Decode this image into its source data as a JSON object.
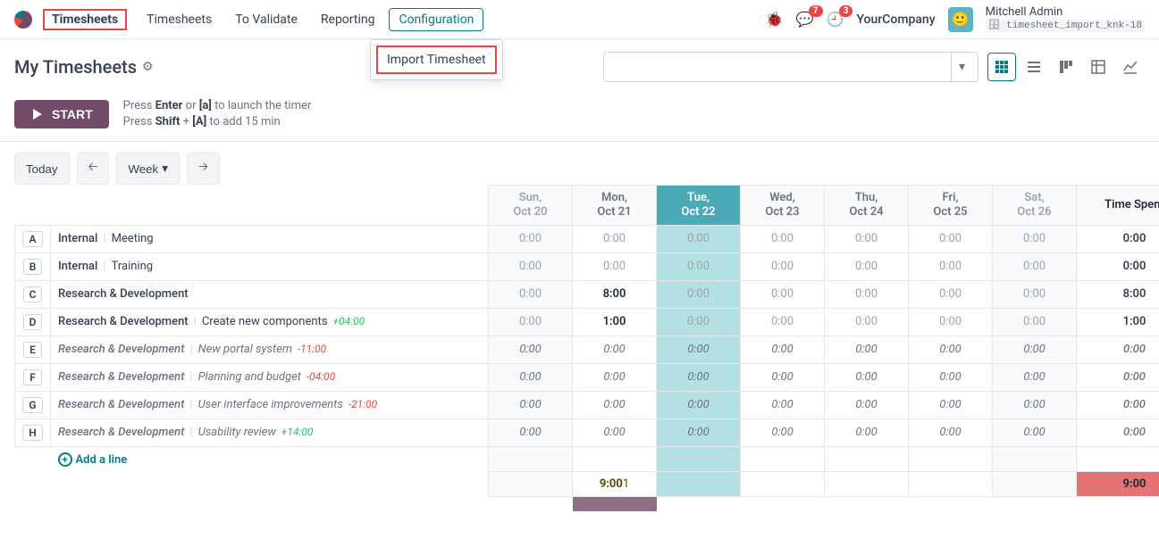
{
  "nav": {
    "app": "Timesheets",
    "links": [
      "Timesheets",
      "To Validate",
      "Reporting",
      "Configuration"
    ],
    "dropdown_item": "Import Timesheet",
    "company": "YourCompany",
    "user": "Mitchell Admin",
    "db": "timesheet_import_knk-18",
    "chat_badge": "7",
    "activity_badge": "3"
  },
  "header": {
    "title": "My Timesheets"
  },
  "hints": {
    "line1_a": "Press ",
    "line1_b": "Enter",
    "line1_c": " or ",
    "line1_d": "[a]",
    "line1_e": " to launch the timer",
    "line2_a": "Press ",
    "line2_b": "Shift",
    "line2_c": " + ",
    "line2_d": "[A]",
    "line2_e": " to add 15 min"
  },
  "start_label": "START",
  "controls": {
    "today": "Today",
    "scale": "Week"
  },
  "days": [
    {
      "top": "Sun,",
      "bot": "Oct 20",
      "kind": "weekend"
    },
    {
      "top": "Mon,",
      "bot": "Oct 21",
      "kind": "normal"
    },
    {
      "top": "Tue,",
      "bot": "Oct 22",
      "kind": "today"
    },
    {
      "top": "Wed,",
      "bot": "Oct 23",
      "kind": "normal"
    },
    {
      "top": "Thu,",
      "bot": "Oct 24",
      "kind": "normal"
    },
    {
      "top": "Fri,",
      "bot": "Oct 25",
      "kind": "normal"
    },
    {
      "top": "Sat,",
      "bot": "Oct 26",
      "kind": "weekend"
    }
  ],
  "time_spent_head": "Time Spent",
  "rows": [
    {
      "key": "A",
      "project": "Internal",
      "task": "Meeting",
      "italic": false,
      "diff": "",
      "cells": [
        "0:00",
        "0:00",
        "0:00",
        "0:00",
        "0:00",
        "0:00",
        "0:00"
      ],
      "spent": "0:00"
    },
    {
      "key": "B",
      "project": "Internal",
      "task": "Training",
      "italic": false,
      "diff": "",
      "cells": [
        "0:00",
        "0:00",
        "0:00",
        "0:00",
        "0:00",
        "0:00",
        "0:00"
      ],
      "spent": "0:00"
    },
    {
      "key": "C",
      "project": "Research & Development",
      "task": "",
      "italic": false,
      "diff": "",
      "cells": [
        "0:00",
        "8:00",
        "0:00",
        "0:00",
        "0:00",
        "0:00",
        "0:00"
      ],
      "spent": "8:00"
    },
    {
      "key": "D",
      "project": "Research & Development",
      "task": "Create new components",
      "italic": false,
      "diff": "+04:00",
      "diffsign": "pos",
      "cells": [
        "0:00",
        "1:00",
        "0:00",
        "0:00",
        "0:00",
        "0:00",
        "0:00"
      ],
      "spent": "1:00"
    },
    {
      "key": "E",
      "project": "Research & Development",
      "task": "New portal system",
      "italic": true,
      "diff": "-11:00",
      "diffsign": "neg",
      "cells": [
        "0:00",
        "0:00",
        "0:00",
        "0:00",
        "0:00",
        "0:00",
        "0:00"
      ],
      "spent": "0:00"
    },
    {
      "key": "F",
      "project": "Research & Development",
      "task": "Planning and budget",
      "italic": true,
      "diff": "-04:00",
      "diffsign": "neg",
      "cells": [
        "0:00",
        "0:00",
        "0:00",
        "0:00",
        "0:00",
        "0:00",
        "0:00"
      ],
      "spent": "0:00"
    },
    {
      "key": "G",
      "project": "Research & Development",
      "task": "User interface improvements",
      "italic": true,
      "diff": "-21:00",
      "diffsign": "neg",
      "cells": [
        "0:00",
        "0:00",
        "0:00",
        "0:00",
        "0:00",
        "0:00",
        "0:00"
      ],
      "spent": "0:00"
    },
    {
      "key": "H",
      "project": "Research & Development",
      "task": "Usability review",
      "italic": true,
      "diff": "+14:00",
      "diffsign": "pos",
      "cells": [
        "0:00",
        "0:00",
        "0:00",
        "0:00",
        "0:00",
        "0:00",
        "0:00"
      ],
      "spent": "0:00"
    }
  ],
  "add_line": "Add a line",
  "footer": {
    "mon_total_main": "9:00",
    "mon_total_suffix": "1",
    "grand": "9:00"
  }
}
